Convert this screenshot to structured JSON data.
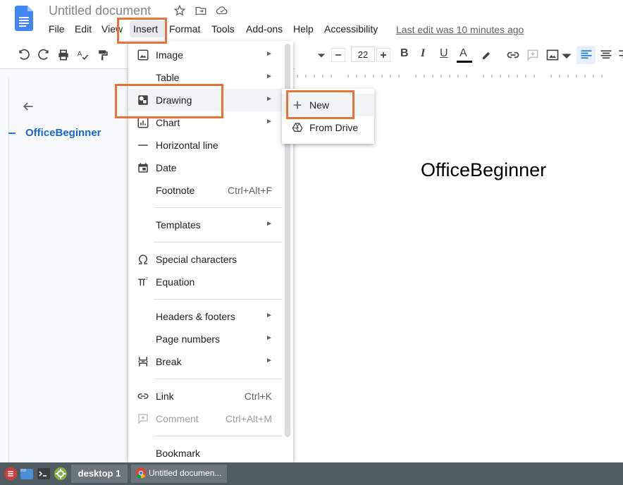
{
  "header": {
    "title": "Untitled document",
    "menus": [
      "File",
      "Edit",
      "View",
      "Insert",
      "Format",
      "Tools",
      "Add-ons",
      "Help",
      "Accessibility"
    ],
    "last_edit": "Last edit was 10 minutes ago"
  },
  "toolbar": {
    "font_size": "22",
    "bold": "B",
    "italic": "I",
    "underline": "U",
    "text_color": "A"
  },
  "outline": {
    "heading": "OfficeBeginner"
  },
  "page": {
    "text": "OfficeBeginner"
  },
  "insert_menu": {
    "items": [
      {
        "label": "Image",
        "icon": "image-icon",
        "arrow": "►"
      },
      {
        "label": "Table",
        "icon": "",
        "arrow": "►"
      },
      {
        "label": "Drawing",
        "icon": "drawing-icon",
        "arrow": "►"
      },
      {
        "label": "Chart",
        "icon": "chart-icon",
        "arrow": "►"
      },
      {
        "label": "Horizontal line",
        "icon": "horizontal-line-icon"
      },
      {
        "label": "Date",
        "icon": "calendar-icon"
      },
      {
        "label": "Footnote",
        "shortcut": "Ctrl+Alt+F"
      },
      {
        "label": "Templates",
        "arrow": "►"
      },
      {
        "label": "Special characters",
        "icon": "omega-icon"
      },
      {
        "label": "Equation",
        "icon": "pi-icon"
      },
      {
        "label": "Headers & footers",
        "arrow": "►"
      },
      {
        "label": "Page numbers",
        "arrow": "►"
      },
      {
        "label": "Break",
        "icon": "break-icon",
        "arrow": "►"
      },
      {
        "label": "Link",
        "icon": "link-icon",
        "shortcut": "Ctrl+K"
      },
      {
        "label": "Comment",
        "icon": "comment-icon",
        "shortcut": "Ctrl+Alt+M",
        "disabled": true
      },
      {
        "label": "Bookmark"
      }
    ]
  },
  "drawing_submenu": {
    "items": [
      {
        "label": "New",
        "icon": "plus-icon"
      },
      {
        "label": "From Drive",
        "icon": "drive-icon"
      }
    ]
  },
  "taskbar": {
    "desktop_label": "desktop 1",
    "task_label": "Untitled documen..."
  },
  "colors": {
    "accent_orange": "#e8733a",
    "doc_blue": "#4285f4",
    "link_blue": "#1967d2"
  }
}
